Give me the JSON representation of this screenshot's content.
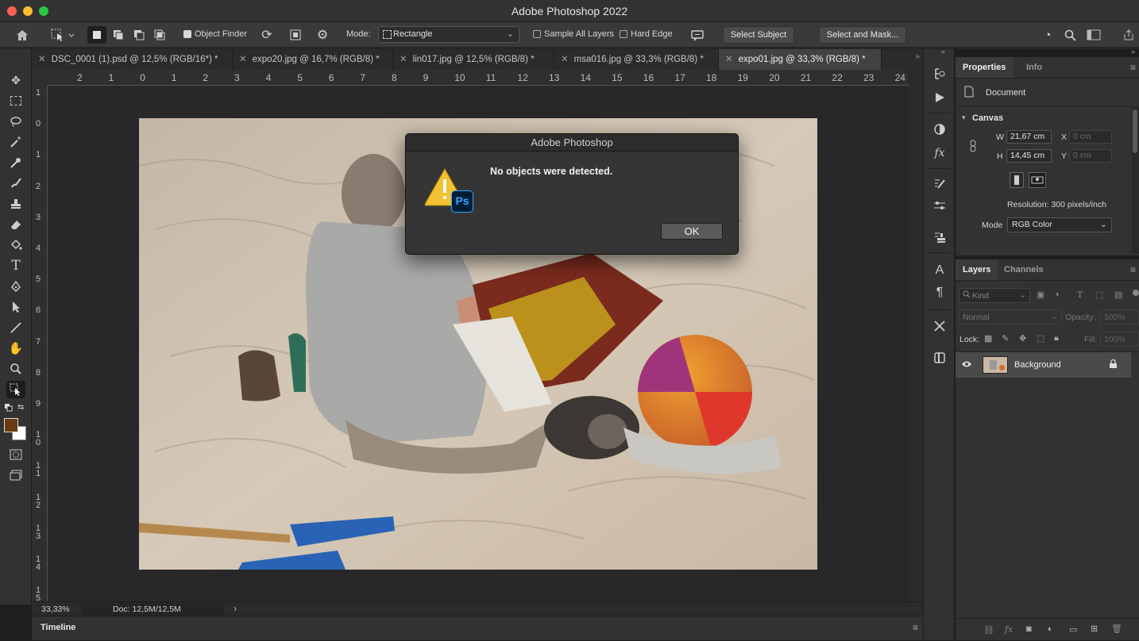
{
  "app": {
    "title": "Adobe Photoshop 2022"
  },
  "options": {
    "object_finder": "Object Finder",
    "mode_label": "Mode:",
    "mode_value": "Rectangle",
    "sample_all_layers": "Sample All Layers",
    "hard_edge": "Hard Edge",
    "select_subject": "Select Subject",
    "select_and_mask": "Select and Mask..."
  },
  "tabs": [
    {
      "label": "DSC_0001 (1).psd @ 12,5% (RGB/16*) *"
    },
    {
      "label": "expo20.jpg @ 16,7% (RGB/8) *"
    },
    {
      "label": "lin017.jpg @ 12,5% (RGB/8) *"
    },
    {
      "label": "msa016.jpg @ 33,3% (RGB/8) *"
    },
    {
      "label": "expo01.jpg @ 33,3% (RGB/8) *"
    }
  ],
  "ruler": {
    "h": [
      "2",
      "1",
      "0",
      "1",
      "2",
      "3",
      "4",
      "5",
      "6",
      "7",
      "8",
      "9",
      "10",
      "11",
      "12",
      "13",
      "14",
      "15",
      "16",
      "17",
      "18",
      "19",
      "20",
      "21",
      "22",
      "23",
      "24"
    ],
    "v": [
      "1",
      "0",
      "1",
      "2",
      "3",
      "4",
      "5",
      "6",
      "7",
      "8",
      "9",
      "10",
      "11",
      "12",
      "13",
      "14",
      "15"
    ]
  },
  "dialog": {
    "title": "Adobe Photoshop",
    "message": "No objects were detected.",
    "ok": "OK",
    "badge": "Ps"
  },
  "status": {
    "zoom": "33,33%",
    "doc": "Doc: 12,5M/12,5M",
    "timeline": "Timeline"
  },
  "properties": {
    "tab_properties": "Properties",
    "tab_info": "Info",
    "document": "Document",
    "canvas": "Canvas",
    "w_label": "W",
    "w_value": "21,67 cm",
    "h_label": "H",
    "h_value": "14,45 cm",
    "x_label": "X",
    "x_placeholder": "0 cm",
    "y_label": "Y",
    "y_placeholder": "0 cm",
    "resolution": "Resolution: 300 pixels/inch",
    "mode_label": "Mode",
    "mode_value": "RGB Color"
  },
  "layers": {
    "tab_layers": "Layers",
    "tab_channels": "Channels",
    "kind": "Kind",
    "blend": "Normal",
    "opacity_label": "Opacity:",
    "opacity_value": "100%",
    "lock_label": "Lock:",
    "fill_label": "Fill:",
    "fill_value": "100%",
    "items": [
      {
        "name": "Background"
      }
    ]
  }
}
